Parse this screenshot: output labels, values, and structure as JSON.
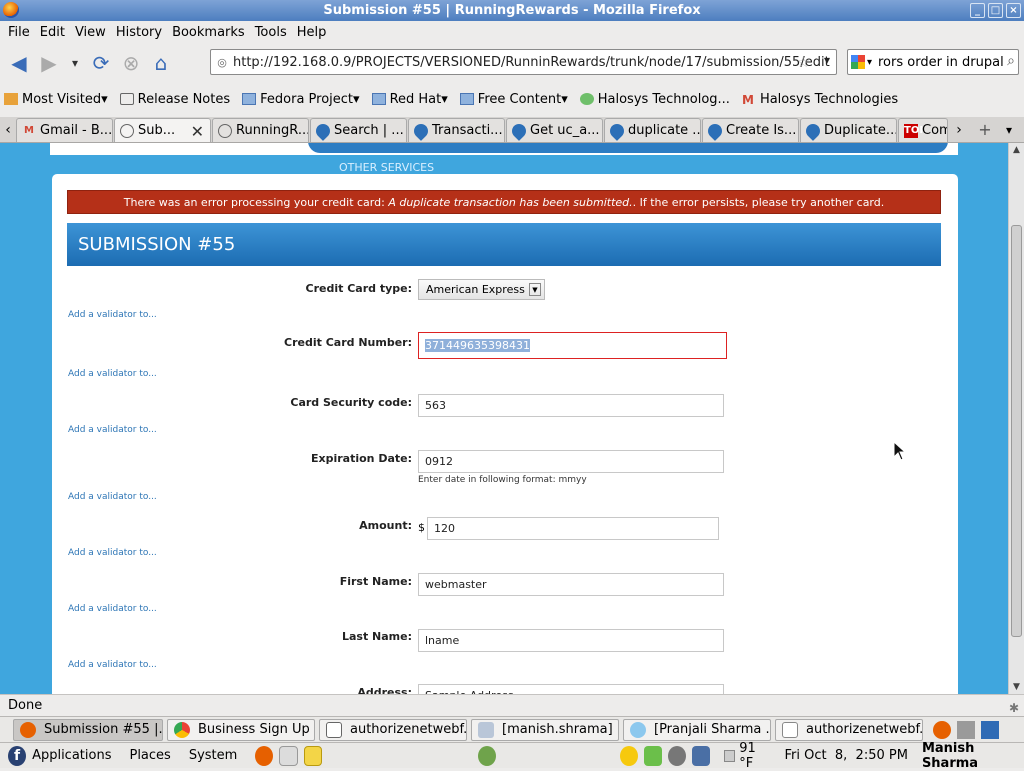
{
  "window": {
    "title": "Submission #55 | RunningRewards - Mozilla Firefox",
    "controls": [
      "_",
      "□",
      "×"
    ]
  },
  "menu": [
    "File",
    "Edit",
    "View",
    "History",
    "Bookmarks",
    "Tools",
    "Help"
  ],
  "nav": {
    "url": "http://192.168.0.9/PROJECTS/VERSIONED/RunninRewards/trunk/node/17/submission/55/edit",
    "search_value": "rors order in drupal"
  },
  "bookmarks": [
    {
      "label": "Most Visited",
      "icon": "folder-icon",
      "menu": true
    },
    {
      "label": "Release Notes",
      "icon": "page-icon",
      "menu": false
    },
    {
      "label": "Fedora Project",
      "icon": "folder-icon",
      "menu": true
    },
    {
      "label": "Red Hat",
      "icon": "folder-icon",
      "menu": true
    },
    {
      "label": "Free Content",
      "icon": "folder-icon",
      "menu": true
    },
    {
      "label": "Halosys Technolog...",
      "icon": "halosys-icon",
      "menu": false
    },
    {
      "label": "Halosys Technologies",
      "icon": "gmail-icon",
      "menu": false
    }
  ],
  "tabs": [
    {
      "label": "Gmail - B...",
      "icon": "gmail-icon",
      "active": false
    },
    {
      "label": "Sub...",
      "icon": "page-icon",
      "active": true
    },
    {
      "label": "RunningR...",
      "icon": "page-icon",
      "active": false
    },
    {
      "label": "Search | ...",
      "icon": "drupal-icon",
      "active": false
    },
    {
      "label": "Transacti...",
      "icon": "drupal-icon",
      "active": false
    },
    {
      "label": "Get uc_a...",
      "icon": "drupal-icon",
      "active": false
    },
    {
      "label": "duplicate ...",
      "icon": "drupal-icon",
      "active": false
    },
    {
      "label": "Create Is...",
      "icon": "drupal-icon",
      "active": false
    },
    {
      "label": "Duplicate...",
      "icon": "drupal-icon",
      "active": false
    },
    {
      "label": "Com",
      "icon": "toi-icon",
      "active": false
    }
  ],
  "page": {
    "other_services": "OTHER SERVICES",
    "error": {
      "prefix": "There was an error processing your credit card: ",
      "detail": "A duplicate transaction has been submitted.",
      "suffix": ". If the error persists, please try another card."
    },
    "heading": "SUBMISSION #55",
    "validator_link": "Add a validator to...",
    "fields": {
      "cc_type": {
        "label": "Credit Card type:",
        "value": "American Express"
      },
      "cc_number": {
        "label": "Credit Card Number:",
        "value": "371449635398431"
      },
      "security": {
        "label": "Card Security code:",
        "value": "563"
      },
      "expiration": {
        "label": "Expiration Date:",
        "value": "0912",
        "hint": "Enter date in following format: mmyy"
      },
      "amount": {
        "label": "Amount:",
        "currency": "$",
        "value": "120"
      },
      "first_name": {
        "label": "First Name:",
        "value": "webmaster"
      },
      "last_name": {
        "label": "Last Name:",
        "value": "lname"
      },
      "address": {
        "label": "Address:",
        "value": "Sample Address"
      }
    }
  },
  "status": "Done",
  "taskbar": [
    {
      "label": "Submission #55 |...",
      "active": true
    },
    {
      "label": "Business Sign Up ...",
      "active": false
    },
    {
      "label": "authorizenetwebf...",
      "active": false
    },
    {
      "label": "[manish.shrama]",
      "active": false
    },
    {
      "label": "[Pranjali Sharma ...",
      "active": false
    },
    {
      "label": "authorizenetwebf...",
      "active": false
    }
  ],
  "panel": {
    "applications": "Applications",
    "places": "Places",
    "system": "System",
    "temperature": "91 °F",
    "datetime": "Fri Oct  8,  2:50 PM",
    "user": "Manish Sharma"
  }
}
